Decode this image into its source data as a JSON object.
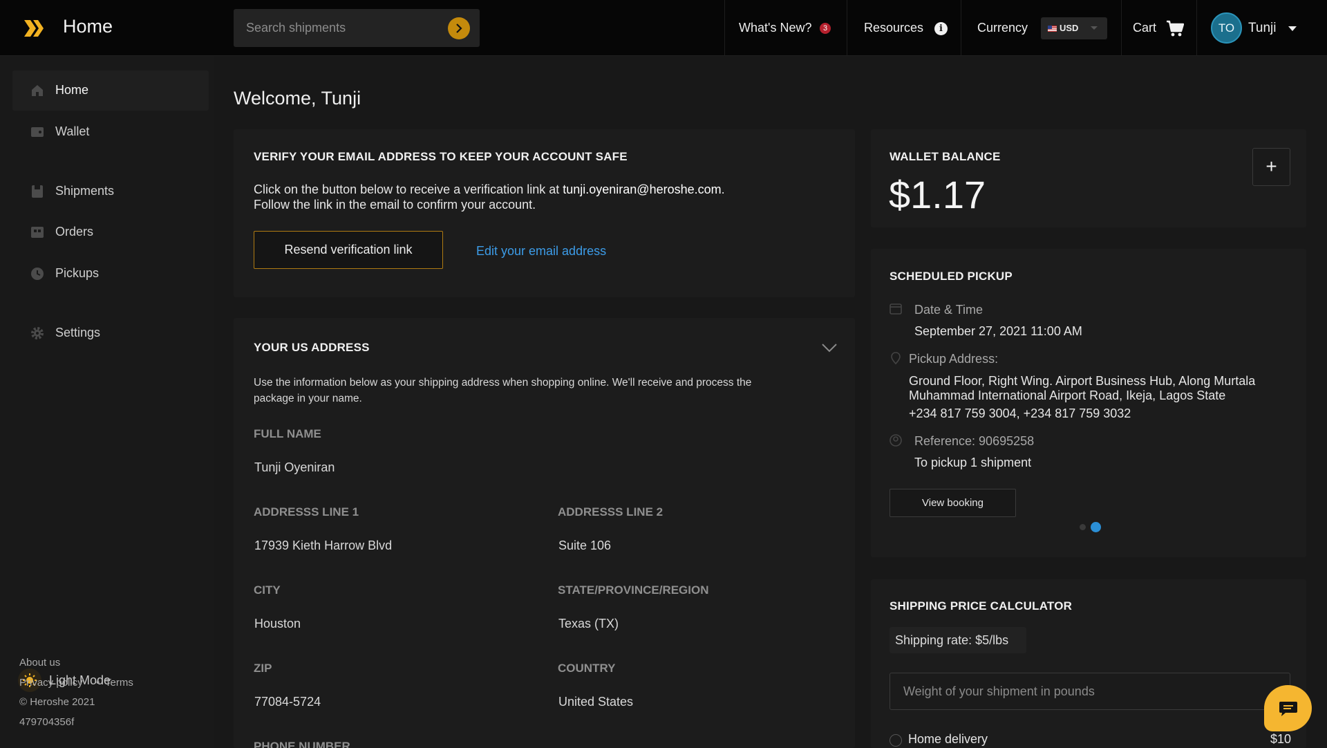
{
  "app": {
    "title": "Home"
  },
  "header": {
    "search_placeholder": "Search shipments",
    "whats_new": "What's New?",
    "whats_new_count": "3",
    "resources": "Resources",
    "currency_label": "Currency",
    "currency_value": "USD",
    "cart": "Cart",
    "user_initials": "TO",
    "user_name": "Tunji"
  },
  "sidebar": {
    "items": [
      {
        "label": "Home",
        "icon": "home-icon"
      },
      {
        "label": "Wallet",
        "icon": "wallet-icon"
      },
      {
        "label": "Shipments",
        "icon": "shipments-icon"
      },
      {
        "label": "Orders",
        "icon": "orders-icon"
      },
      {
        "label": "Pickups",
        "icon": "clock-icon"
      },
      {
        "label": "Settings",
        "icon": "gear-icon"
      }
    ],
    "mode_toggle": "Light Mode",
    "footer": {
      "about": "About us",
      "privacy": "Privacy policy",
      "separator": "•",
      "terms": "Terms",
      "copyright": "© Heroshe 2021",
      "build": "479704356f"
    }
  },
  "main": {
    "welcome": "Welcome, Tunji",
    "verify": {
      "title": "VERIFY YOUR EMAIL ADDRESS TO KEEP YOUR ACCOUNT SAFE",
      "line1_prefix": "Click on the button below to receive a verification link at ",
      "email": "tunji.oyeniran@heroshe.com",
      "line1_suffix": ".",
      "line2": "Follow the link in the email to confirm your account.",
      "resend_button": "Resend verification link",
      "edit_link": "Edit your email address"
    },
    "us_address": {
      "title": "YOUR US ADDRESS",
      "description_line1": "Use the information below as your shipping address when shopping online. We'll receive and process the",
      "description_line2": "package in your name.",
      "full_name_label": "FULL NAME",
      "full_name": "Tunji Oyeniran",
      "address1_label": "ADDRESSS LINE 1",
      "address1": "17939 Kieth Harrow Blvd",
      "address2_label": "ADDRESSS LINE 2",
      "address2": "Suite 106",
      "city_label": "CITY",
      "city": "Houston",
      "state_label": "STATE/PROVINCE/REGION",
      "state": "Texas (TX)",
      "zip_label": "ZIP",
      "zip": "77084-5724",
      "country_label": "COUNTRY",
      "country": "United States",
      "phone_label": "PHONE NUMBER"
    }
  },
  "wallet": {
    "title": "WALLET BALANCE",
    "balance": "$1.17",
    "add_button": "+"
  },
  "pickup": {
    "title": "SCHEDULED PICKUP",
    "datetime_label": "Date & Time",
    "datetime": "September 27, 2021 11:00 AM",
    "address_label": "Pickup Address:",
    "address_line1": "Ground Floor, Right Wing. Airport Business Hub, Along Murtala",
    "address_line2": "Muhammad International Airport Road, Ikeja, Lagos State",
    "phones": "+234 817 759 3004, +234 817 759 3032",
    "reference": "Reference: 90695258",
    "count": "To pickup 1 shipment",
    "view_button": "View booking",
    "carousel_active": 2,
    "carousel_total": 2
  },
  "calculator": {
    "title": "SHIPPING PRICE CALCULATOR",
    "rate": "Shipping rate: $5/lbs",
    "weight_placeholder": "Weight of your shipment in pounds",
    "home_delivery_label": "Home delivery",
    "home_delivery_price": "$10"
  },
  "colors": {
    "accent": "#c48a0c",
    "link": "#3c9ce8",
    "avatar": "#1b6f8d",
    "badge": "#b5202d",
    "chat": "#f5b630"
  }
}
